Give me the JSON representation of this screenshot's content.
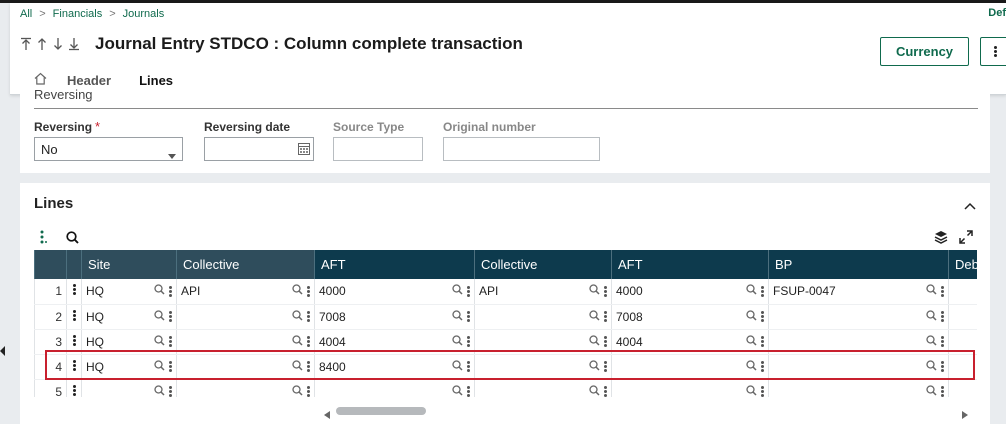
{
  "breadcrumb": [
    "All",
    "Financials",
    "Journals"
  ],
  "top_right_label": "Def",
  "page_title": "Journal Entry STDCO : Column complete transaction",
  "buttons": {
    "currency": "Currency"
  },
  "tabs": [
    {
      "label": "Header",
      "active": false
    },
    {
      "label": "Lines",
      "active": true
    }
  ],
  "reversing_section": {
    "label": "Reversing",
    "fields": {
      "reversing": {
        "label": "Reversing",
        "required": true,
        "value": "No"
      },
      "reversing_date": {
        "label": "Reversing date",
        "value": ""
      },
      "source_type": {
        "label": "Source Type",
        "value": ""
      },
      "original_number": {
        "label": "Original number",
        "value": ""
      }
    }
  },
  "lines_section": {
    "title": "Lines",
    "columns": [
      "Site",
      "Collective",
      "AFT",
      "Collective",
      "AFT",
      "BP",
      "Deb"
    ],
    "rows": [
      {
        "num": "1",
        "site": "HQ",
        "collective1": "API",
        "aft1": "4000",
        "collective2": "API",
        "aft2": "4000",
        "bp": "FSUP-0047"
      },
      {
        "num": "2",
        "site": "HQ",
        "collective1": "",
        "aft1": "7008",
        "collective2": "",
        "aft2": "7008",
        "bp": ""
      },
      {
        "num": "3",
        "site": "HQ",
        "collective1": "",
        "aft1": "4004",
        "collective2": "",
        "aft2": "4004",
        "bp": ""
      },
      {
        "num": "4",
        "site": "HQ",
        "collective1": "",
        "aft1": "8400",
        "collective2": "",
        "aft2": "",
        "bp": ""
      },
      {
        "num": "5",
        "site": "",
        "collective1": "",
        "aft1": "",
        "collective2": "",
        "aft2": "",
        "bp": ""
      }
    ],
    "highlighted_row": "4"
  },
  "colors": {
    "accent": "#0f6a4d",
    "header_dark": "#0d3a4d",
    "header_light": "#2f4d5c",
    "highlight": "#c8202e"
  },
  "icons": [
    "home-icon",
    "first-icon",
    "previous-icon",
    "next-icon",
    "last-icon",
    "kebab-menu-icon",
    "search-icon",
    "layers-icon",
    "expand-icon",
    "chevron-up-icon",
    "calendar-icon",
    "caret-down-icon"
  ]
}
